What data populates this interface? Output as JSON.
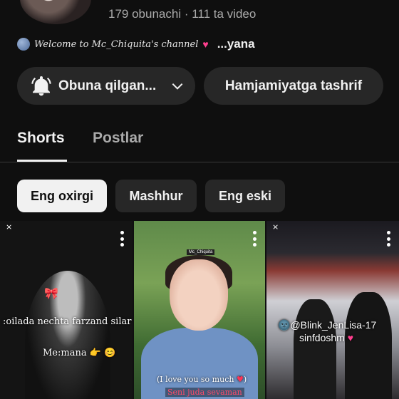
{
  "channel": {
    "stats": "179 obunachi · 111 ta video",
    "description_script": "Welcome to Mc_Chiquita's channel",
    "description_more": "...yana"
  },
  "buttons": {
    "subscribed": "Obuna qilgan...",
    "community": "Hamjamiyatga tashrif"
  },
  "tabs": [
    {
      "label": "Shorts",
      "active": true
    },
    {
      "label": "Postlar",
      "active": false
    }
  ],
  "chips": [
    {
      "label": "Eng oxirgi",
      "active": true
    },
    {
      "label": "Mashhur",
      "active": false
    },
    {
      "label": "Eng eski",
      "active": false
    }
  ],
  "shorts": [
    {
      "caption_1": ":oilada nechta farzand silar ...?",
      "caption_2": "Me:mana"
    },
    {
      "watermark": "Mc_Chiquita",
      "caption_1": "(I love you so much",
      "caption_2": "Seni juda sevaman"
    },
    {
      "caption_1": "@Blink_JenLisa-17",
      "caption_2": "sinfdoshm"
    }
  ]
}
